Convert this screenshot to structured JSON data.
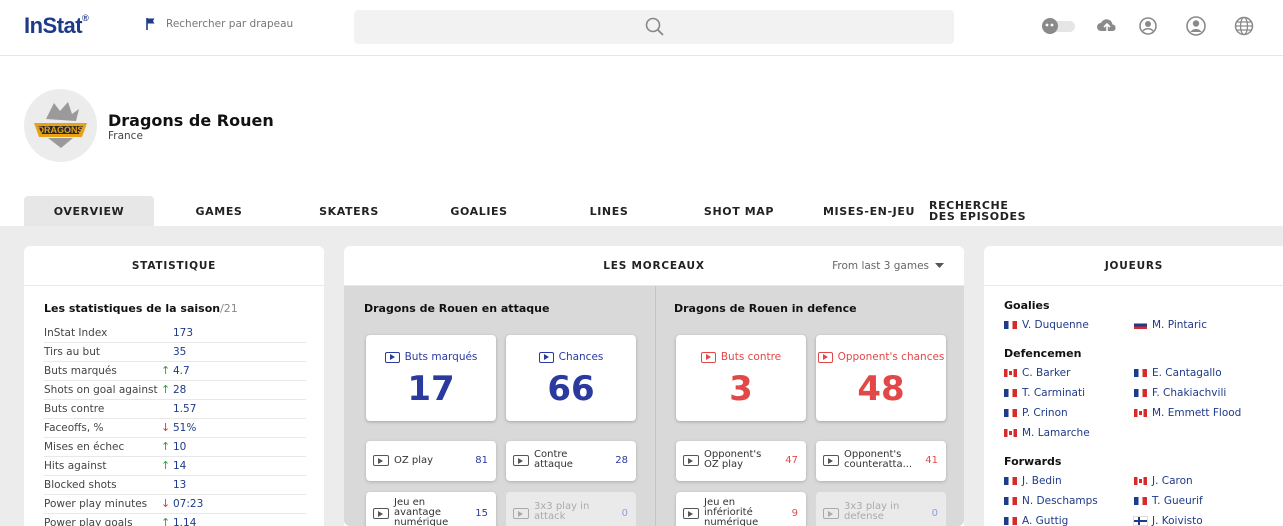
{
  "header": {
    "logo": "InStat",
    "logo_mark": "®",
    "flag_search": "Rechercher par drapeau"
  },
  "team": {
    "name": "Dragons de Rouen",
    "country": "France",
    "logo_text": "DRAGONS"
  },
  "tabs": [
    {
      "label": "OVERVIEW",
      "active": true
    },
    {
      "label": "GAMES"
    },
    {
      "label": "SKATERS"
    },
    {
      "label": "GOALIES"
    },
    {
      "label": "LINES"
    },
    {
      "label": "SHOT MAP"
    },
    {
      "label": "MISES-EN-JEU"
    },
    {
      "label": "RECHERCHE DES EPISODES"
    }
  ],
  "stats": {
    "title": "STATISTIQUE",
    "season_label": "Les statistiques de la saison",
    "season_year": "/21",
    "rows": [
      {
        "label": "InStat Index",
        "trend": "",
        "value": "173"
      },
      {
        "label": "Tirs au but",
        "trend": "",
        "value": "35"
      },
      {
        "label": "Buts marqués",
        "trend": "up",
        "value": "4.7"
      },
      {
        "label": "Shots on goal against",
        "trend": "up",
        "value": "28"
      },
      {
        "label": "Buts contre",
        "trend": "",
        "value": "1.57"
      },
      {
        "label": "Faceoffs, %",
        "trend": "down",
        "value": "51%"
      },
      {
        "label": "Mises en échec",
        "trend": "up",
        "value": "10"
      },
      {
        "label": "Hits against",
        "trend": "up",
        "value": "14"
      },
      {
        "label": "Blocked shots",
        "trend": "",
        "value": "13"
      },
      {
        "label": "Power play minutes",
        "trend": "down",
        "value": "07:23"
      },
      {
        "label": "Power play goals",
        "trend": "up",
        "value": "1.14"
      }
    ]
  },
  "morceaux": {
    "title": "LES MORCEAUX",
    "filter": "From last 3 games",
    "attack": {
      "title": "Dragons de Rouen en attaque",
      "big": [
        {
          "label": "Buts marqués",
          "value": "17"
        },
        {
          "label": "Chances",
          "value": "66"
        }
      ],
      "small": [
        {
          "label": "OZ play",
          "value": "81"
        },
        {
          "label": "Contre attaque",
          "value": "28"
        },
        {
          "label": "Jeu en avantage numérique",
          "value": "15"
        },
        {
          "label": "3x3 play in attack",
          "value": "0"
        }
      ]
    },
    "defence": {
      "title": "Dragons de Rouen in defence",
      "big": [
        {
          "label": "Buts contre",
          "value": "3"
        },
        {
          "label": "Opponent's chances",
          "value": "48"
        }
      ],
      "small": [
        {
          "label": "Opponent's OZ play",
          "value": "47"
        },
        {
          "label": "Opponent's counteratta...",
          "value": "41"
        },
        {
          "label": "Jeu en infériorité numérique",
          "value": "9"
        },
        {
          "label": "3x3 play in defense",
          "value": "0"
        }
      ]
    }
  },
  "players": {
    "title": "JOUEURS",
    "goalies_label": "Goalies",
    "goalies": [
      {
        "name": "V. Duquenne",
        "flag": "fr"
      },
      {
        "name": "M. Pintaric",
        "flag": "si"
      }
    ],
    "defencemen_label": "Defencemen",
    "defencemen": [
      {
        "name": "C. Barker",
        "flag": "ca"
      },
      {
        "name": "E. Cantagallo",
        "flag": "fr"
      },
      {
        "name": "T. Carminati",
        "flag": "fr"
      },
      {
        "name": "F. Chakiachvili",
        "flag": "fr"
      },
      {
        "name": "P. Crinon",
        "flag": "fr"
      },
      {
        "name": "M. Emmett Flood",
        "flag": "ca"
      },
      {
        "name": "M. Lamarche",
        "flag": "ca"
      }
    ],
    "forwards_label": "Forwards",
    "forwards": [
      {
        "name": "J. Bedin",
        "flag": "fr"
      },
      {
        "name": "J. Caron",
        "flag": "ca"
      },
      {
        "name": "N. Deschamps",
        "flag": "fr"
      },
      {
        "name": "T. Gueurif",
        "flag": "fr"
      },
      {
        "name": "A. Guttig",
        "flag": "fr"
      },
      {
        "name": "J. Koivisto",
        "flag": "fi"
      }
    ]
  }
}
